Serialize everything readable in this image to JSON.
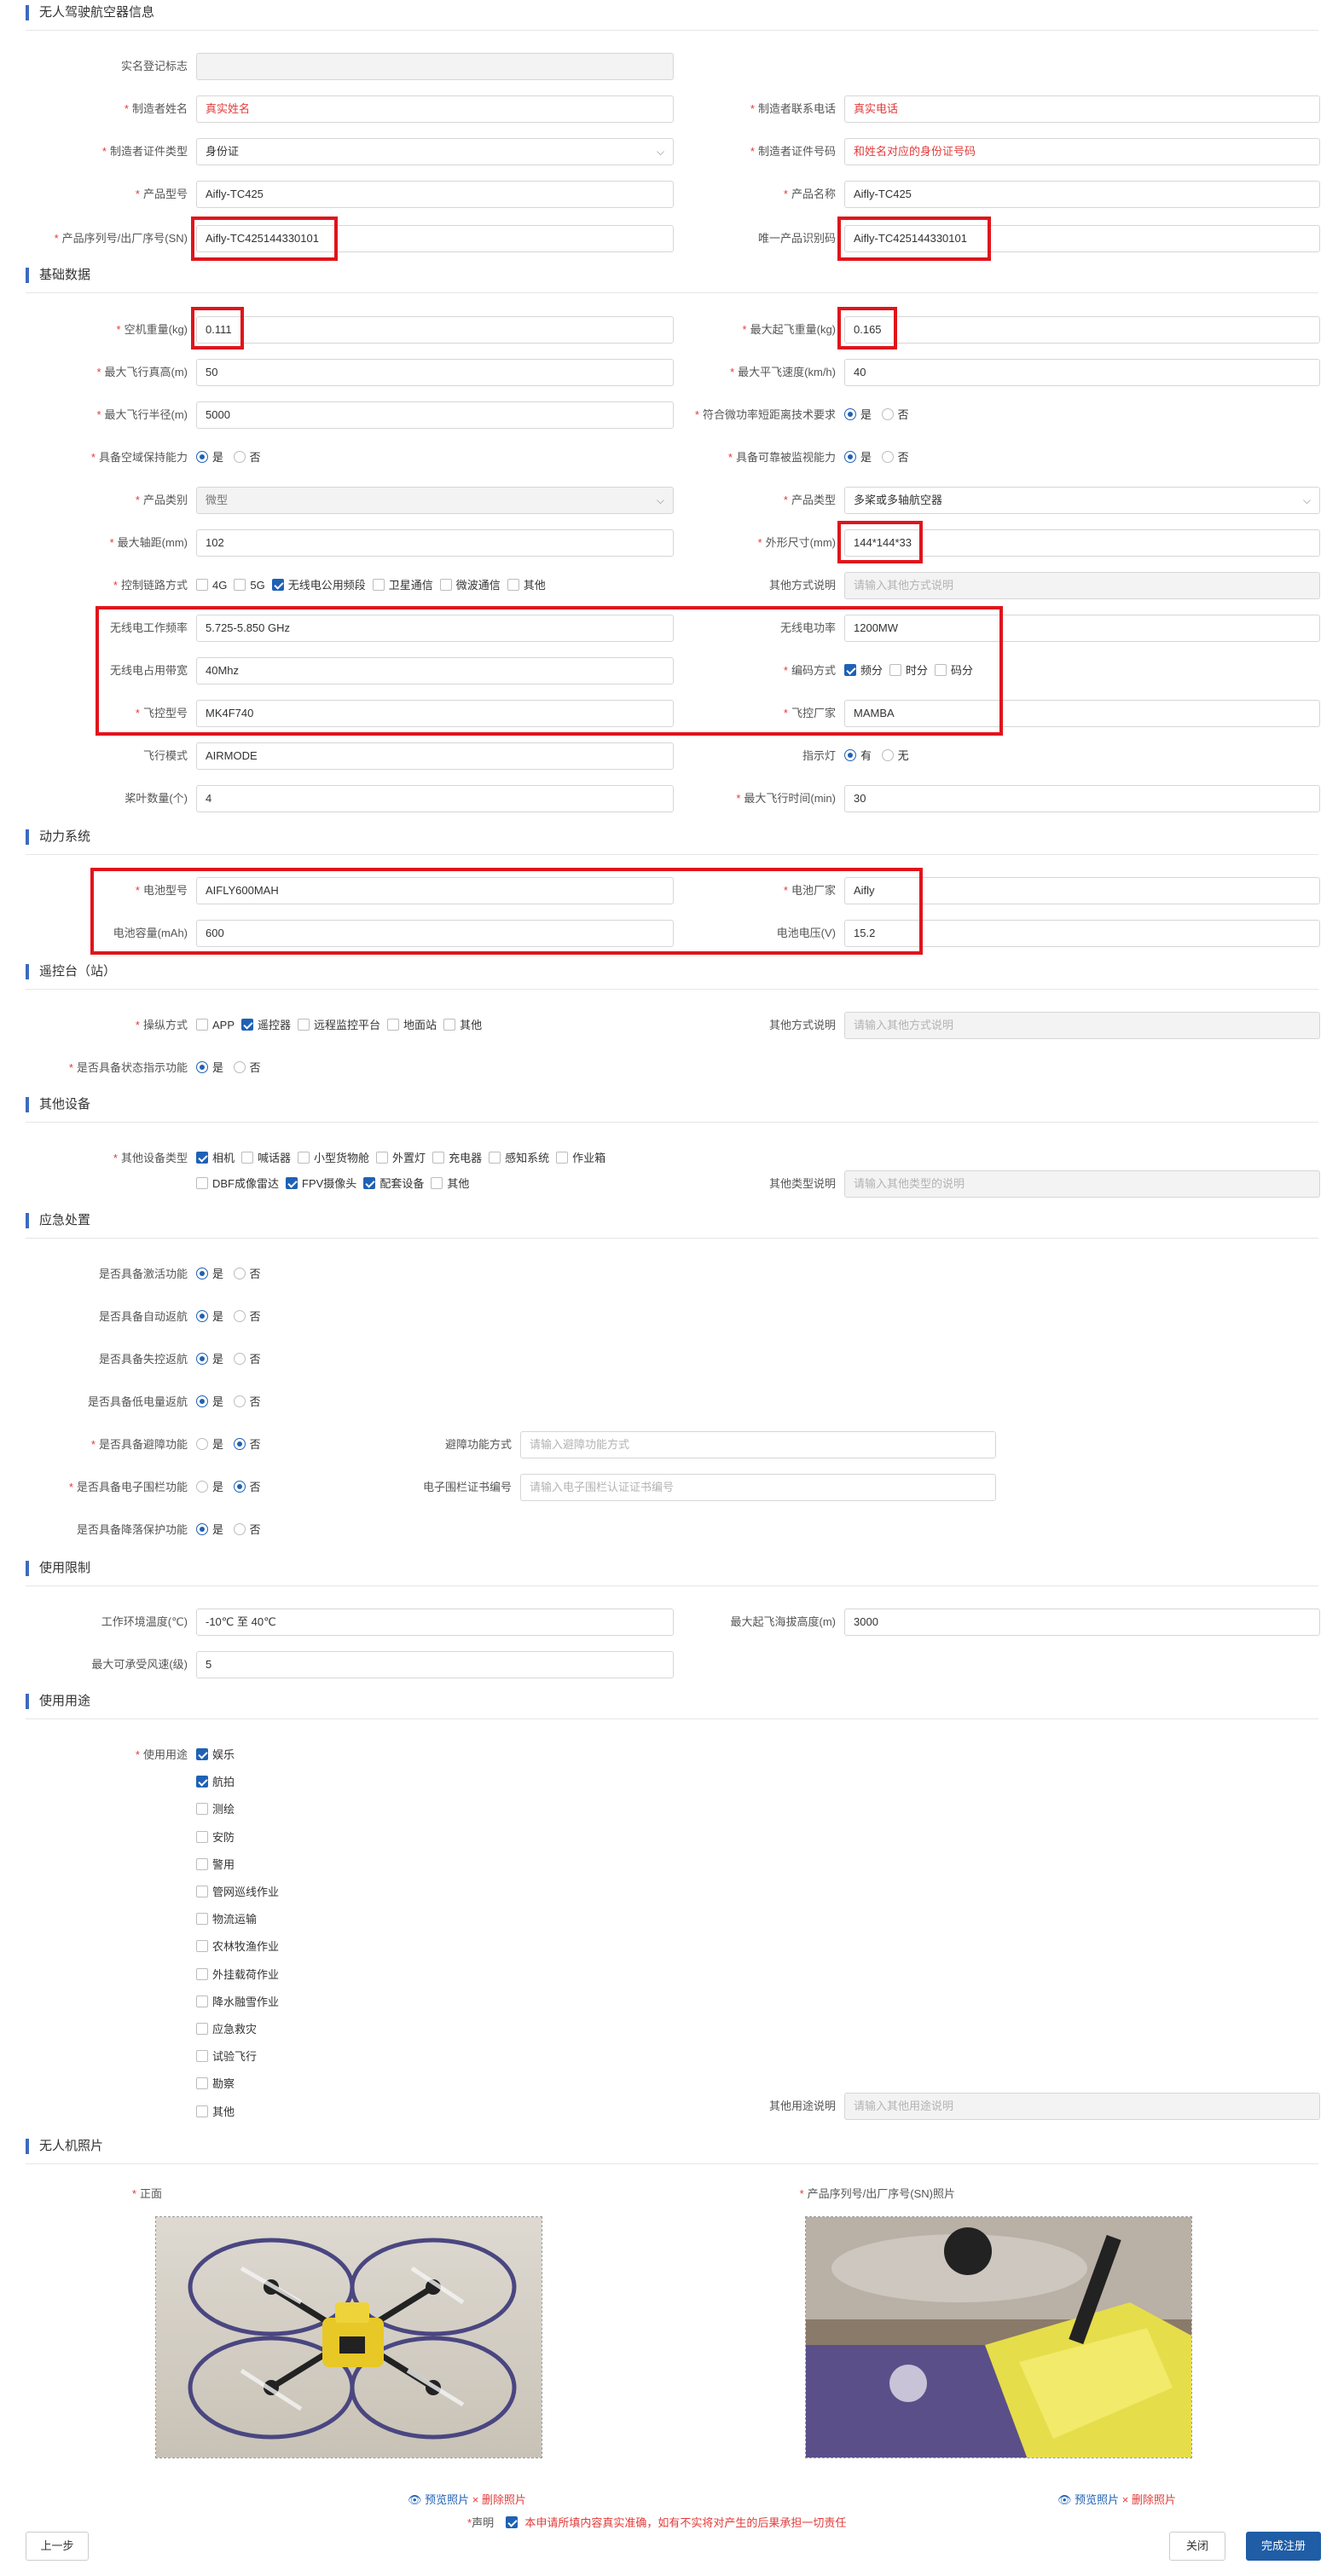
{
  "sections": {
    "uav_info": "无人驾驶航空器信息",
    "basic": "基础数据",
    "power": "动力系统",
    "rc": "遥控台（站）",
    "other_equipment": "其他设备",
    "emergency": "应急处置",
    "limits": "使用限制",
    "purpose": "使用用途",
    "photos": "无人机照片"
  },
  "uav_info": {
    "realname_label": "实名登记标志",
    "realname_value": "",
    "maker_name_label": "制造者姓名",
    "maker_name_value": "真实姓名",
    "maker_phone_label": "制造者联系电话",
    "maker_phone_value": "真实电话",
    "id_type_label": "制造者证件类型",
    "id_type_value": "身份证",
    "id_no_label": "制造者证件号码",
    "id_no_value": "和姓名对应的身份证号码",
    "model_label": "产品型号",
    "model_value": "Aifly-TC425",
    "name_label": "产品名称",
    "name_value": "Aifly-TC425",
    "sn_label": "产品序列号/出厂序号(SN)",
    "sn_value": "Aifly-TC425144330101",
    "uid_label": "唯一产品识别码",
    "uid_value": "Aifly-TC425144330101"
  },
  "basic": {
    "empty_weight_label": "空机重量(kg)",
    "empty_weight_value": "0.111",
    "max_takeoff_label": "最大起飞重量(kg)",
    "max_takeoff_value": "0.165",
    "max_alt_label": "最大飞行真高(m)",
    "max_alt_value": "50",
    "max_speed_label": "最大平飞速度(km/h)",
    "max_speed_value": "40",
    "max_radius_label": "最大飞行半径(m)",
    "max_radius_value": "5000",
    "micro_power_label": "符合微功率短距离技术要求",
    "micro_power_yes": "是",
    "micro_power_no": "否",
    "airspace_label": "具备空域保持能力",
    "airspace_yes": "是",
    "airspace_no": "否",
    "monitor_label": "具备可靠被监视能力",
    "monitor_yes": "是",
    "monitor_no": "否",
    "category_label": "产品类别",
    "category_value": "微型",
    "type_label": "产品类型",
    "type_value": "多桨或多轴航空器",
    "wheelbase_label": "最大轴距(mm)",
    "wheelbase_value": "102",
    "size_label": "外形尺寸(mm)",
    "size_value": "144*144*33",
    "link_label": "控制链路方式",
    "link_options": [
      {
        "label": "4G",
        "on": false
      },
      {
        "label": "5G",
        "on": false
      },
      {
        "label": "无线电公用频段",
        "on": true
      },
      {
        "label": "卫星通信",
        "on": false
      },
      {
        "label": "微波通信",
        "on": false
      },
      {
        "label": "其他",
        "on": false
      }
    ],
    "other_link_label": "其他方式说明",
    "other_link_placeholder": "请输入其他方式说明",
    "freq_label": "无线电工作频率",
    "freq_value": "5.725-5.850 GHz",
    "radio_power_label": "无线电功率",
    "radio_power_value": "1200MW",
    "bandwidth_label": "无线电占用带宽",
    "bandwidth_value": "40Mhz",
    "encoding_label": "编码方式",
    "encoding_options": [
      {
        "label": "频分",
        "on": true
      },
      {
        "label": "时分",
        "on": false
      },
      {
        "label": "码分",
        "on": false
      }
    ],
    "fc_model_label": "飞控型号",
    "fc_model_value": "MK4F740",
    "fc_maker_label": "飞控厂家",
    "fc_maker_value": "MAMBA",
    "flight_mode_label": "飞行模式",
    "flight_mode_value": "AIRMODE",
    "indicator_label": "指示灯",
    "indicator_yes": "有",
    "indicator_no": "无",
    "blades_label": "桨叶数量(个)",
    "blades_value": "4",
    "max_time_label": "最大飞行时间(min)",
    "max_time_value": "30"
  },
  "power": {
    "battery_model_label": "电池型号",
    "battery_model_value": "AIFLY600MAH",
    "battery_maker_label": "电池厂家",
    "battery_maker_value": "Aifly",
    "capacity_label": "电池容量(mAh)",
    "capacity_value": "600",
    "voltage_label": "电池电压(V)",
    "voltage_value": "15.2"
  },
  "rc": {
    "mode_label": "操纵方式",
    "mode_options": [
      {
        "label": "APP",
        "on": false
      },
      {
        "label": "遥控器",
        "on": true
      },
      {
        "label": "远程监控平台",
        "on": false
      },
      {
        "label": "地面站",
        "on": false
      },
      {
        "label": "其他",
        "on": false
      }
    ],
    "other_label": "其他方式说明",
    "other_placeholder": "请输入其他方式说明",
    "status_label": "是否具备状态指示功能",
    "yes": "是",
    "no": "否"
  },
  "other_equipment": {
    "type_label": "其他设备类型",
    "options_row1": [
      {
        "label": "相机",
        "on": true
      },
      {
        "label": "喊话器",
        "on": false
      },
      {
        "label": "小型货物舱",
        "on": false
      },
      {
        "label": "外置灯",
        "on": false
      },
      {
        "label": "充电器",
        "on": false
      },
      {
        "label": "感知系统",
        "on": false
      },
      {
        "label": "作业箱",
        "on": false
      }
    ],
    "options_row2": [
      {
        "label": "DBF成像雷达",
        "on": false
      },
      {
        "label": "FPV摄像头",
        "on": true
      },
      {
        "label": "配套设备",
        "on": true
      },
      {
        "label": "其他",
        "on": false
      }
    ],
    "other_label": "其他类型说明",
    "other_placeholder": "请输入其他类型的说明"
  },
  "emergency": {
    "yes": "是",
    "no": "否",
    "activate_label": "是否具备激活功能",
    "auto_return_label": "是否具备自动返航",
    "lost_return_label": "是否具备失控返航",
    "low_batt_label": "是否具备低电量返航",
    "avoid_label": "是否具备避障功能",
    "avoid_method_label": "避障功能方式",
    "avoid_method_placeholder": "请输入避障功能方式",
    "fence_label": "是否具备电子围栏功能",
    "fence_cert_label": "电子围栏证书编号",
    "fence_cert_placeholder": "请输入电子围栏认证证书编号",
    "landing_label": "是否具备降落保护功能"
  },
  "limits": {
    "temp_label": "工作环境温度(℃)",
    "temp_value": "-10℃ 至 40℃",
    "altitude_label": "最大起飞海拔高度(m)",
    "altitude_value": "3000",
    "wind_label": "最大可承受风速(级)",
    "wind_value": "5"
  },
  "purpose": {
    "label": "使用用途",
    "options": [
      {
        "label": "娱乐",
        "on": true
      },
      {
        "label": "航拍",
        "on": true
      },
      {
        "label": "测绘",
        "on": false
      },
      {
        "label": "安防",
        "on": false
      },
      {
        "label": "警用",
        "on": false
      },
      {
        "label": "管网巡线作业",
        "on": false
      },
      {
        "label": "物流运输",
        "on": false
      },
      {
        "label": "农林牧渔作业",
        "on": false
      },
      {
        "label": "外挂载荷作业",
        "on": false
      },
      {
        "label": "降水融雪作业",
        "on": false
      },
      {
        "label": "应急救灾",
        "on": false
      },
      {
        "label": "试验飞行",
        "on": false
      },
      {
        "label": "勘察",
        "on": false
      },
      {
        "label": "其他",
        "on": false
      }
    ],
    "other_label": "其他用途说明",
    "other_placeholder": "请输入其他用途说明"
  },
  "photos": {
    "front_label": "正面",
    "sn_label": "产品序列号/出厂序号(SN)照片",
    "preview": "预览照片",
    "delete": "删除照片"
  },
  "declaration": {
    "label": "声明",
    "text": "本申请所填内容真实准确，如有不实将对产生的后果承担一切责任"
  },
  "buttons": {
    "prev": "上一步",
    "close": "关闭",
    "finish": "完成注册"
  },
  "colors": {
    "accent": "#1f5da6",
    "required": "#e23b3b",
    "highlight_box": "#e0141c"
  }
}
